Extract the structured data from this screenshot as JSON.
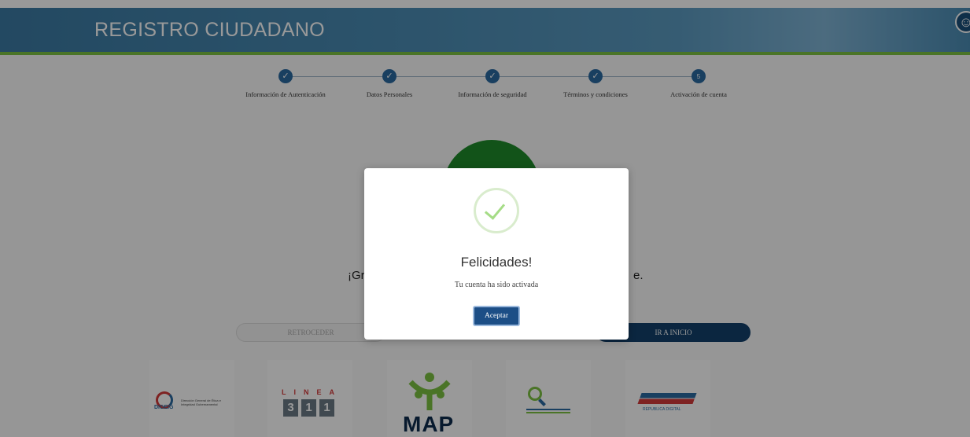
{
  "header": {
    "title": "REGISTRO CIUDADANO",
    "accessibility_icon": "accessibility-icon"
  },
  "stepper": {
    "steps": [
      {
        "label": "Información de Autenticación",
        "status": "done",
        "icon": "check-icon"
      },
      {
        "label": "Datos Personales",
        "status": "done",
        "icon": "check-icon"
      },
      {
        "label": "Información de seguridad",
        "status": "done",
        "icon": "check-icon"
      },
      {
        "label": "Términos y condiciones",
        "status": "done",
        "icon": "check-icon"
      },
      {
        "label": "Activación de cuenta",
        "status": "current",
        "number": "5"
      }
    ]
  },
  "page": {
    "thanks_left": "¡Gr",
    "thanks_right": "e.",
    "back_button": "RETROCEDER",
    "home_button": "IR A INICIO"
  },
  "logos": {
    "dgeig": {
      "acronym": "DIGEIG",
      "text": "Dirección General de Ética e Integridad Gubernamental"
    },
    "linea311": {
      "top": "LINEA",
      "digits": [
        "3",
        "1",
        "1"
      ]
    },
    "map": {
      "text": "MAP"
    },
    "lupa": {
      "icon": "magnifier-logo"
    },
    "rd": {
      "text": "REPUBLICA DIGITAL"
    }
  },
  "modal": {
    "icon": "success-check-icon",
    "title": "Felicidades!",
    "message": "Tu cuenta ha sido activada",
    "button": "Aceptar"
  },
  "colors": {
    "header": "#4a8bb3",
    "header_stripe": "#7cc242",
    "primary": "#1c4e86",
    "success": "#a5dc86",
    "green_circle": "#1e8a2a"
  }
}
